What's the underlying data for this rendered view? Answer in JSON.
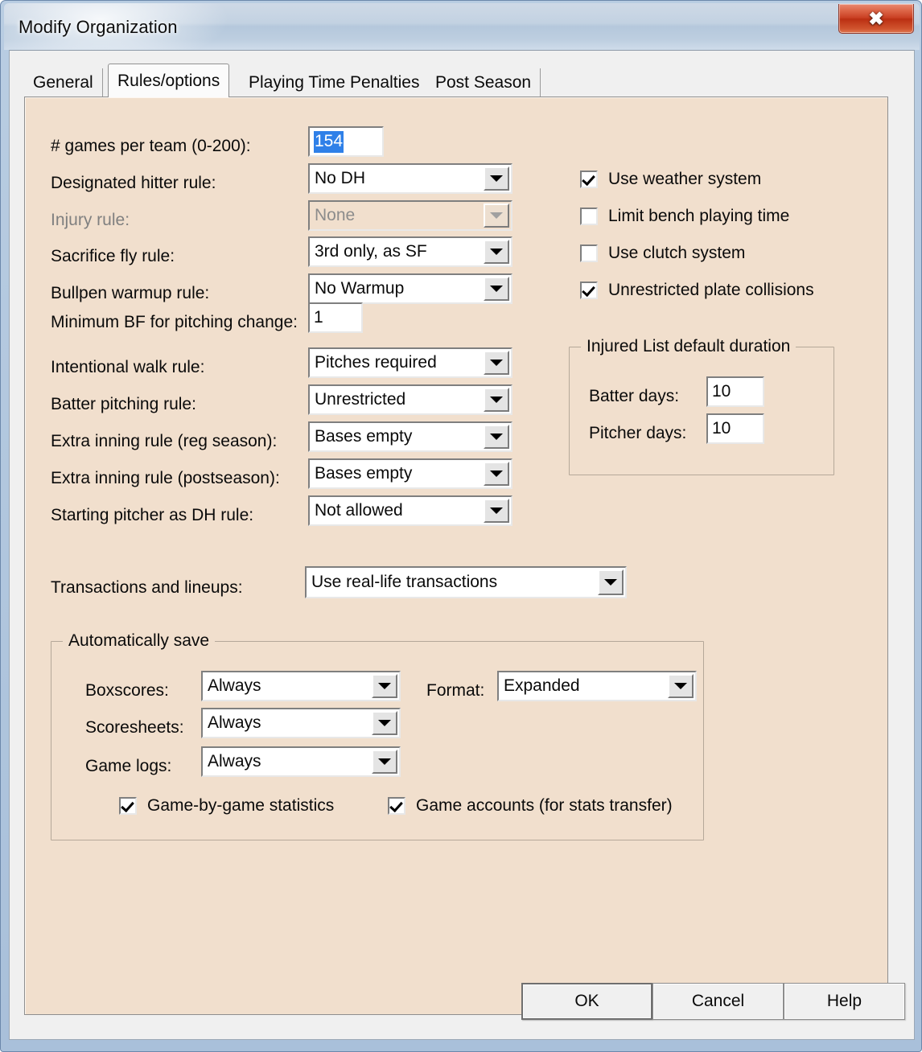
{
  "window": {
    "title": "Modify Organization",
    "close_label": "✖"
  },
  "tabs": [
    {
      "label": "General",
      "active": false
    },
    {
      "label": "Rules/options",
      "active": true
    },
    {
      "label": "Playing Time Penalties",
      "active": false
    },
    {
      "label": "Post Season",
      "active": false
    }
  ],
  "form": {
    "games_per_team": {
      "label": "# games per team (0-200):",
      "value": "154",
      "selected": true
    },
    "designated_hitter": {
      "label": "Designated hitter rule:",
      "value": "No DH"
    },
    "injury_rule": {
      "label": "Injury rule:",
      "value": "None",
      "disabled": true
    },
    "sacrifice_fly": {
      "label": "Sacrifice fly rule:",
      "value": "3rd only, as SF"
    },
    "bullpen_warmup": {
      "label": "Bullpen warmup rule:",
      "value": "No Warmup"
    },
    "minimum_bf": {
      "label": "Minimum BF for pitching change:",
      "value": "1"
    },
    "intentional_walk": {
      "label": "Intentional walk rule:",
      "value": "Pitches required"
    },
    "batter_pitching": {
      "label": "Batter pitching rule:",
      "value": "Unrestricted"
    },
    "extra_inning_reg": {
      "label": "Extra inning rule (reg season):",
      "value": "Bases empty"
    },
    "extra_inning_post": {
      "label": "Extra inning rule (postseason):",
      "value": "Bases empty"
    },
    "starting_pitcher_dh": {
      "label": "Starting pitcher as DH rule:",
      "value": "Not allowed"
    },
    "transactions": {
      "label": "Transactions and lineups:",
      "value": "Use real-life transactions"
    }
  },
  "checkboxes": [
    {
      "label": "Use weather system",
      "checked": true
    },
    {
      "label": "Limit bench playing time",
      "checked": false
    },
    {
      "label": "Use clutch system",
      "checked": false
    },
    {
      "label": "Unrestricted plate collisions",
      "checked": true
    }
  ],
  "injured_list": {
    "title": "Injured List default duration",
    "batter_days": {
      "label": "Batter days:",
      "value": "10"
    },
    "pitcher_days": {
      "label": "Pitcher days:",
      "value": "10"
    }
  },
  "auto_save": {
    "title": "Automatically save",
    "boxscores": {
      "label": "Boxscores:",
      "value": "Always"
    },
    "scoresheets": {
      "label": "Scoresheets:",
      "value": "Always"
    },
    "game_logs": {
      "label": "Game logs:",
      "value": "Always"
    },
    "format": {
      "label": "Format:",
      "value": "Expanded"
    },
    "game_by_game": {
      "label": "Game-by-game statistics",
      "checked": true
    },
    "game_accounts": {
      "label": "Game accounts (for stats transfer)",
      "checked": true
    }
  },
  "footer": {
    "ok": "OK",
    "cancel": "Cancel",
    "help": "Help"
  },
  "colors": {
    "tab_page_bg": "#f1dfcd",
    "dialog_bg": "#f0f0f0",
    "selection_blue": "#2f80e8",
    "close_red": "#c93f22"
  }
}
